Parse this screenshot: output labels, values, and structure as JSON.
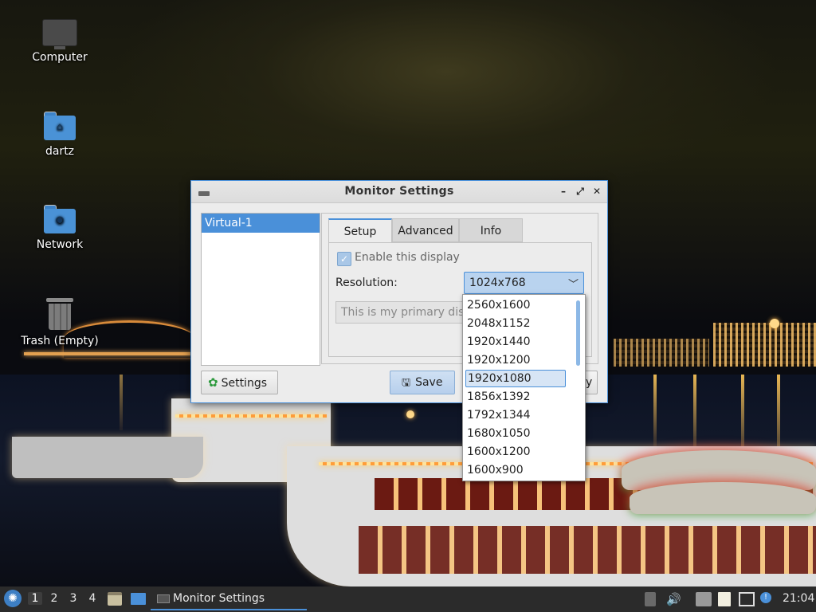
{
  "desktop": {
    "icons": [
      {
        "label": "Computer",
        "icon": "computer-icon"
      },
      {
        "label": "dartz",
        "icon": "home-folder-icon"
      },
      {
        "label": "Network",
        "icon": "network-folder-icon"
      },
      {
        "label": "Trash (Empty)",
        "icon": "trash-icon"
      }
    ]
  },
  "window": {
    "title": "Monitor Settings",
    "monitors": [
      "Virtual-1"
    ],
    "tabs": [
      "Setup",
      "Advanced",
      "Info"
    ],
    "active_tab": "Setup",
    "setup": {
      "enable_label": "Enable this display",
      "enable_checked": true,
      "resolution_label": "Resolution:",
      "resolution_value": "1024x768",
      "primary_label": "This is my primary disp"
    },
    "buttons": {
      "settings": "Settings",
      "save": "Save",
      "apply_partial": "y"
    }
  },
  "dropdown": {
    "options": [
      "2560x1600",
      "2048x1152",
      "1920x1440",
      "1920x1200",
      "1920x1080",
      "1856x1392",
      "1792x1344",
      "1680x1050",
      "1600x1200",
      "1600x900"
    ],
    "highlighted": "1920x1080"
  },
  "taskbar": {
    "workspaces": [
      "1",
      "2",
      "3",
      "4"
    ],
    "active_workspace": "1",
    "task_title": "Monitor Settings",
    "clock": "21:04"
  },
  "colors": {
    "accent": "#4a90d9",
    "taskbar": "#2b2b2b",
    "dialog_bg": "#ececec"
  }
}
